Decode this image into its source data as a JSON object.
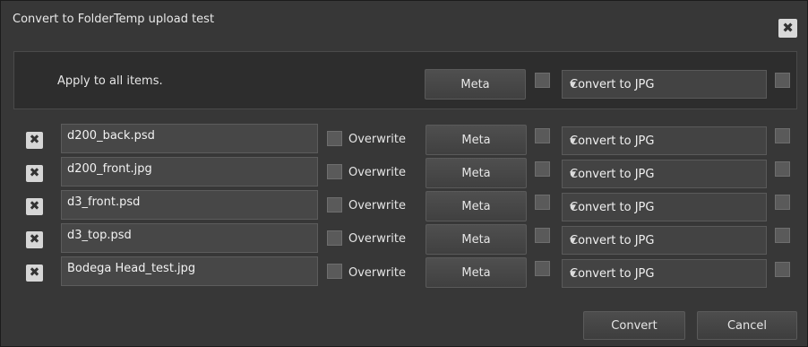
{
  "dialog": {
    "title": "Convert to FolderTemp upload test",
    "close_icon": "close-icon"
  },
  "apply_all": {
    "label": "Apply to all  items.",
    "meta_label": "Meta",
    "format_selected": "Convert to JPG"
  },
  "items": [
    {
      "name": "d200_back.psd",
      "overwrite_label": "Overwrite",
      "meta_label": "Meta",
      "format_selected": "Convert to JPG"
    },
    {
      "name": "d200_front.jpg",
      "overwrite_label": "Overwrite",
      "meta_label": "Meta",
      "format_selected": "Convert to JPG"
    },
    {
      "name": "d3_front.psd",
      "overwrite_label": "Overwrite",
      "meta_label": "Meta",
      "format_selected": "Convert to JPG"
    },
    {
      "name": "d3_top.psd",
      "overwrite_label": "Overwrite",
      "meta_label": "Meta",
      "format_selected": "Convert to JPG"
    },
    {
      "name": "Bodega Head_test.jpg",
      "overwrite_label": "Overwrite",
      "meta_label": "Meta",
      "format_selected": "Convert to JPG"
    }
  ],
  "footer": {
    "convert_label": "Convert",
    "cancel_label": "Cancel"
  }
}
